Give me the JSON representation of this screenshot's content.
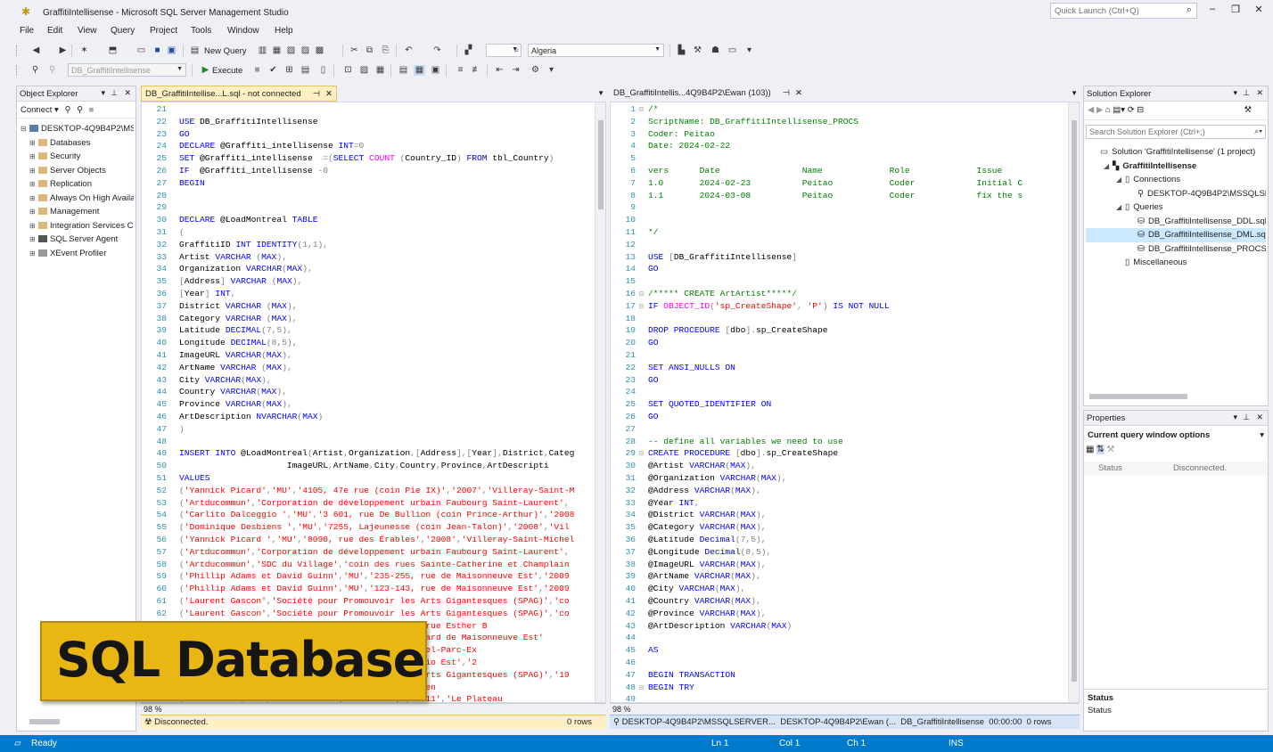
{
  "window": {
    "title": "GraffitiIntellisense - Microsoft SQL Server Management Studio",
    "quick_launch_placeholder": "Quick Launch (Ctrl+Q)"
  },
  "menu": [
    "File",
    "Edit",
    "View",
    "Query",
    "Project",
    "Tools",
    "Window",
    "Help"
  ],
  "toolbar": {
    "new_query": "New Query",
    "solution_config": "Algeria",
    "database": "DB_GraffitiIntellisense",
    "execute": "Execute"
  },
  "object_explorer": {
    "title": "Object Explorer",
    "connect": "Connect",
    "items": [
      {
        "label": "DESKTOP-4Q9B4P2\\MSS",
        "expand": "⊟",
        "icon": "server-icon"
      },
      {
        "label": "Databases",
        "expand": "⊞",
        "icon": "folder-icon"
      },
      {
        "label": "Security",
        "expand": "⊞",
        "icon": "folder-icon"
      },
      {
        "label": "Server Objects",
        "expand": "⊞",
        "icon": "folder-icon"
      },
      {
        "label": "Replication",
        "expand": "⊞",
        "icon": "folder-icon"
      },
      {
        "label": "Always On High Availa",
        "expand": "⊞",
        "icon": "folder-icon"
      },
      {
        "label": "Management",
        "expand": "⊞",
        "icon": "folder-icon"
      },
      {
        "label": "Integration Services Ca",
        "expand": "⊞",
        "icon": "folder-icon"
      },
      {
        "label": "SQL Server Agent",
        "expand": "⊞",
        "icon": "agent-icon"
      },
      {
        "label": "XEvent Profiler",
        "expand": "⊞",
        "icon": "profiler-icon"
      }
    ]
  },
  "left_editor": {
    "tab": "DB_GraffitiIntellise...L.sql - not connected",
    "zoom": "98 %",
    "status": "Disconnected.",
    "rows": "0 rows",
    "lines": [
      {
        "n": "21",
        "t": ""
      },
      {
        "n": "22",
        "t": "USE DB_GraffitiIntellisense"
      },
      {
        "n": "23",
        "t": "GO"
      },
      {
        "n": "24",
        "t": "DECLARE @Graffiti_intellisense INT=0"
      },
      {
        "n": "25",
        "t": "SET @Graffiti_intellisense  =(SELECT COUNT (Country_ID) FROM tbl_Country)"
      },
      {
        "n": "26",
        "t": "IF  @Graffiti_intellisense -0"
      },
      {
        "n": "27",
        "t": "BEGIN"
      },
      {
        "n": "28",
        "t": ""
      },
      {
        "n": "29",
        "t": ""
      },
      {
        "n": "30",
        "t": "DECLARE @LoadMontreal TABLE"
      },
      {
        "n": "31",
        "t": "("
      },
      {
        "n": "32",
        "t": "GraffitiID INT IDENTITY(1,1),"
      },
      {
        "n": "33",
        "t": "Artist VARCHAR (MAX),"
      },
      {
        "n": "34",
        "t": "Organization VARCHAR(MAX),"
      },
      {
        "n": "35",
        "t": "[Address] VARCHAR (MAX),"
      },
      {
        "n": "36",
        "t": "[Year] INT,"
      },
      {
        "n": "37",
        "t": "District VARCHAR (MAX),"
      },
      {
        "n": "38",
        "t": "Category VARCHAR (MAX),"
      },
      {
        "n": "39",
        "t": "Latitude DECIMAL(7,5),"
      },
      {
        "n": "40",
        "t": "Longitude DECIMAL(8,5),"
      },
      {
        "n": "41",
        "t": "ImageURL VARCHAR(MAX),"
      },
      {
        "n": "42",
        "t": "ArtName VARCHAR (MAX),"
      },
      {
        "n": "43",
        "t": "City VARCHAR(MAX),"
      },
      {
        "n": "44",
        "t": "Country VARCHAR(MAX),"
      },
      {
        "n": "45",
        "t": "Province VARCHAR(MAX),"
      },
      {
        "n": "46",
        "t": "ArtDescription NVARCHAR(MAX)"
      },
      {
        "n": "47",
        "t": ")"
      },
      {
        "n": "48",
        "t": ""
      },
      {
        "n": "49",
        "t": "INSERT INTO @LoadMontreal(Artist,Organization,[Address],[Year],District,Categ"
      },
      {
        "n": "50",
        "t": "                     ImageURL,ArtName,City,Country,Province,ArtDescripti"
      },
      {
        "n": "51",
        "t": "VALUES"
      },
      {
        "n": "52",
        "t": "('Yannick Picard','MU','4105, 47e rue (coin Pie IX)','2007','Villeray-Saint-M"
      },
      {
        "n": "53",
        "t": "('Artducommun','Corporation de développement urbain Faubourg Saint-Laurent',"
      },
      {
        "n": "54",
        "t": "('Carlito Dalceggio ','MU','3 601, rue De Bullion (coin Prince-Arthur)','2008"
      },
      {
        "n": "55",
        "t": "('Dominique Desbiens ','MU','7255, Lajeunesse (coin Jean-Talon)','2008','Vil"
      },
      {
        "n": "56",
        "t": "('Yannick Picard ','MU','8090, rue des Érables','2008','Villeray-Saint-Michel"
      },
      {
        "n": "57",
        "t": "('Artducommun','Corporation de développement urbain Faubourg Saint-Laurent',"
      },
      {
        "n": "58",
        "t": "('Artducommun','SDC du Village','coin des rues Sainte-Catherine et Champlain"
      },
      {
        "n": "59",
        "t": "('Phillip Adams et David Guinn','MU','235-255, rue de Maisonneuve Est','2009"
      },
      {
        "n": "60",
        "t": "('Phillip Adams et David Guinn','MU','123-143, rue de Maisonneuve Est','2009"
      },
      {
        "n": "61",
        "t": "('Laurent Gascon','Société pour Promouvoir les Arts Gigantesques (SPAG)','co"
      },
      {
        "n": "62",
        "t": "('Laurent Gascon','Société pour Promouvoir les Arts Gigantesques (SPAG)','co"
      },
      {
        "n": "63",
        "t": "('Les Ateliers Charlotte de Lachine','MU','740, rue Esther B"
      },
      {
        "n": "64",
        "t": "('Dodo Osé et Bruno Rathbone','MU','3500, boulevard de Maisonneuve Est'"
      },
      {
        "n": "65",
        "t": "('Marc-André Beaudoin','MU','Villeray-Saint-Michel-Parc-Ex"
      },
      {
        "n": "66",
        "t": "('Laurent Gascon','Société','MU','200, rue Ontario Est','2"
      },
      {
        "n": "67",
        "t": "('Laurent Gascon','Société pour Promouvoir les Arts Gigantesques (SPAG)','19"
      },
      {
        "n": "68",
        "t": "('Collectif','MU','Dodo et Bruno Rathbone','Préven"
      },
      {
        "n": "69",
        "t": "('Collectif','MU','rue Ontario (coin Berri)','2011','Le Plateau"
      }
    ]
  },
  "right_editor": {
    "tab": "DB_GraffitiIntellis...4Q9B4P2\\Ewan (103))",
    "zoom": "98 %",
    "status_parts": [
      "DESKTOP-4Q9B4P2\\MSSQLSERVER...",
      "DESKTOP-4Q9B4P2\\Ewan (...",
      "DB_GraffitiIntellisense",
      "00:00:00",
      "0 rows"
    ],
    "lines": [
      {
        "n": "1",
        "t": "/*"
      },
      {
        "n": "2",
        "t": "ScriptName: DB_GraffitiIntellisense_PROCS"
      },
      {
        "n": "3",
        "t": "Coder: Peitao"
      },
      {
        "n": "4",
        "t": "Date: 2024-02-22"
      },
      {
        "n": "5",
        "t": ""
      },
      {
        "n": "6",
        "t": "vers      Date                Name             Role             Issue"
      },
      {
        "n": "7",
        "t": "1.0       2024-02-23          Peitao           Coder            Initial C"
      },
      {
        "n": "8",
        "t": "1.1       2024-03-08          Peitao           Coder            fix the s"
      },
      {
        "n": "9",
        "t": ""
      },
      {
        "n": "10",
        "t": ""
      },
      {
        "n": "11",
        "t": "*/"
      },
      {
        "n": "12",
        "t": ""
      },
      {
        "n": "13",
        "t": "USE [DB_GraffitiIntellisense]"
      },
      {
        "n": "14",
        "t": "GO"
      },
      {
        "n": "15",
        "t": ""
      },
      {
        "n": "16",
        "t": "/***** CREATE ArtArtist*****/"
      },
      {
        "n": "17",
        "t": "IF OBJECT_ID('sp_CreateShape', 'P') IS NOT NULL"
      },
      {
        "n": "18",
        "t": ""
      },
      {
        "n": "19",
        "t": "DROP PROCEDURE [dbo].sp_CreateShape"
      },
      {
        "n": "20",
        "t": "GO"
      },
      {
        "n": "21",
        "t": ""
      },
      {
        "n": "22",
        "t": "SET ANSI_NULLS ON"
      },
      {
        "n": "23",
        "t": "GO"
      },
      {
        "n": "24",
        "t": ""
      },
      {
        "n": "25",
        "t": "SET QUOTED_IDENTIFIER ON"
      },
      {
        "n": "26",
        "t": "GO"
      },
      {
        "n": "27",
        "t": ""
      },
      {
        "n": "28",
        "t": "-- define all variables we need to use"
      },
      {
        "n": "29",
        "t": "CREATE PROCEDURE [dbo].sp_CreateShape"
      },
      {
        "n": "30",
        "t": "@Artist VARCHAR(MAX),"
      },
      {
        "n": "31",
        "t": "@Organization VARCHAR(MAX),"
      },
      {
        "n": "32",
        "t": "@Address VARCHAR(MAX),"
      },
      {
        "n": "33",
        "t": "@Year INT,"
      },
      {
        "n": "34",
        "t": "@District VARCHAR(MAX),"
      },
      {
        "n": "35",
        "t": "@Category VARCHAR(MAX),"
      },
      {
        "n": "36",
        "t": "@Latitude Decimal(7,5),"
      },
      {
        "n": "37",
        "t": "@Longitude Decimal(8,5),"
      },
      {
        "n": "38",
        "t": "@ImageURL VARCHAR(MAX),"
      },
      {
        "n": "39",
        "t": "@ArtName VARCHAR(MAX),"
      },
      {
        "n": "40",
        "t": "@City VARCHAR(MAX),"
      },
      {
        "n": "41",
        "t": "@Country VARCHAR(MAX),"
      },
      {
        "n": "42",
        "t": "@Province VARCHAR(MAX),"
      },
      {
        "n": "43",
        "t": "@ArtDescription VARCHAR(MAX)"
      },
      {
        "n": "44",
        "t": ""
      },
      {
        "n": "45",
        "t": "AS"
      },
      {
        "n": "46",
        "t": ""
      },
      {
        "n": "47",
        "t": "BEGIN TRANSACTION"
      },
      {
        "n": "48",
        "t": "BEGIN TRY"
      },
      {
        "n": "49",
        "t": ""
      }
    ]
  },
  "solution_explorer": {
    "title": "Solution Explorer",
    "search_placeholder": "Search Solution Explorer (Ctrl+;)",
    "items": [
      {
        "label": "Solution 'GraffitiIntellisense' (1 project)",
        "indent": 0,
        "icon": "solution-icon",
        "bold": false
      },
      {
        "label": "GraffitiIntellisense",
        "indent": 1,
        "icon": "project-icon",
        "bold": true
      },
      {
        "label": "Connections",
        "indent": 2,
        "icon": "folder-icon",
        "bold": false
      },
      {
        "label": "DESKTOP-4Q9B4P2\\MSSQLSER",
        "indent": 3,
        "icon": "connection-icon",
        "bold": false
      },
      {
        "label": "Queries",
        "indent": 2,
        "icon": "folder-icon",
        "bold": false
      },
      {
        "label": "DB_GraffitiIntellisense_DDL.sql",
        "indent": 3,
        "icon": "sql-file-icon",
        "bold": false
      },
      {
        "label": "DB_GraffitiIntellisense_DML.sql",
        "indent": 3,
        "icon": "sql-file-icon",
        "bold": false,
        "selected": true
      },
      {
        "label": "DB_GraffitiIntellisense_PROCS.s",
        "indent": 3,
        "icon": "sql-file-icon",
        "bold": false
      },
      {
        "label": "Miscellaneous",
        "indent": 2,
        "icon": "folder-icon",
        "bold": false
      }
    ]
  },
  "properties": {
    "title": "Properties",
    "object": "Current query window options",
    "status_label": "Status",
    "status_value": "Disconnected.",
    "desc_title": "Status",
    "desc_text": "Status"
  },
  "statusbar": {
    "ready": "Ready",
    "ln": "Ln 1",
    "col": "Col 1",
    "ch": "Ch 1",
    "ins": "INS"
  },
  "overlay": {
    "text": "SQL Database"
  },
  "colors": {
    "accent": "#007acc",
    "tab_active": "#1c97ea",
    "keyword": "#0000ff",
    "string": "#ff0000",
    "comment": "#008000",
    "badge": "#e8b714"
  }
}
